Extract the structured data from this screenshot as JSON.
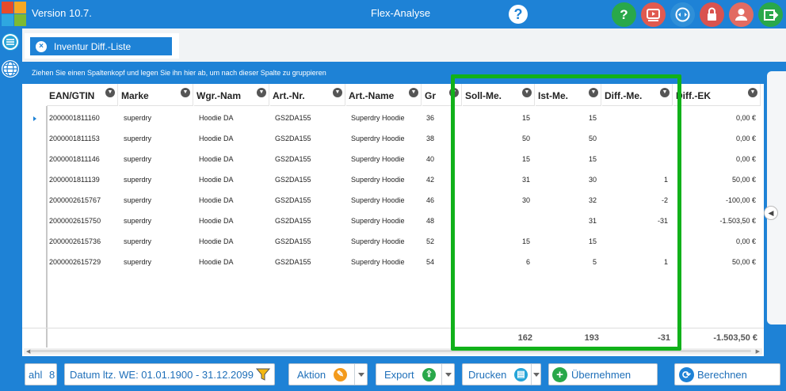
{
  "app": {
    "version": "Version 10.7.",
    "title": "Flex-Analyse"
  },
  "colors": {
    "brand": "#1e82d6",
    "highlight": "#11b11a",
    "toolbar_green": "#29a84a",
    "toolbar_red": "#d9534f"
  },
  "toolbar": {
    "help_center_glyph": "?",
    "help_glyph": "?"
  },
  "tab": {
    "label": "Inventur Diff.-Liste",
    "close_glyph": "×"
  },
  "grid": {
    "group_hint": "Ziehen Sie einen Spaltenkopf und legen Sie ihn hier ab, um nach dieser Spalte zu gruppieren",
    "columns": [
      "EAN/GTIN",
      "Marke",
      "Wgr.-Nam",
      "Art.-Nr.",
      "Art.-Name",
      "Gr",
      "Soll-Me.",
      "Ist-Me.",
      "Diff.-Me.",
      "Diff.-EK"
    ],
    "rows": [
      {
        "ean": "2000001811160",
        "marke": "superdry",
        "wgr": "Hoodie DA",
        "artnr": "GS2DA155",
        "artname": "Superdry Hoodie",
        "gr": "36",
        "soll": "15",
        "ist": "15",
        "diff": "",
        "ek": "0,00 €"
      },
      {
        "ean": "2000001811153",
        "marke": "superdry",
        "wgr": "Hoodie DA",
        "artnr": "GS2DA155",
        "artname": "Superdry Hoodie",
        "gr": "38",
        "soll": "50",
        "ist": "50",
        "diff": "",
        "ek": "0,00 €"
      },
      {
        "ean": "2000001811146",
        "marke": "superdry",
        "wgr": "Hoodie DA",
        "artnr": "GS2DA155",
        "artname": "Superdry Hoodie",
        "gr": "40",
        "soll": "15",
        "ist": "15",
        "diff": "",
        "ek": "0,00 €"
      },
      {
        "ean": "2000001811139",
        "marke": "superdry",
        "wgr": "Hoodie DA",
        "artnr": "GS2DA155",
        "artname": "Superdry Hoodie",
        "gr": "42",
        "soll": "31",
        "ist": "30",
        "diff": "1",
        "ek": "50,00 €"
      },
      {
        "ean": "2000002615767",
        "marke": "superdry",
        "wgr": "Hoodie DA",
        "artnr": "GS2DA155",
        "artname": "Superdry Hoodie",
        "gr": "46",
        "soll": "30",
        "ist": "32",
        "diff": "-2",
        "ek": "-100,00 €"
      },
      {
        "ean": "2000002615750",
        "marke": "superdry",
        "wgr": "Hoodie DA",
        "artnr": "GS2DA155",
        "artname": "Superdry Hoodie",
        "gr": "48",
        "soll": "",
        "ist": "31",
        "diff": "-31",
        "ek": "-1.503,50 €"
      },
      {
        "ean": "2000002615736",
        "marke": "superdry",
        "wgr": "Hoodie DA",
        "artnr": "GS2DA155",
        "artname": "Superdry Hoodie",
        "gr": "52",
        "soll": "15",
        "ist": "15",
        "diff": "",
        "ek": "0,00 €"
      },
      {
        "ean": "2000002615729",
        "marke": "superdry",
        "wgr": "Hoodie DA",
        "artnr": "GS2DA155",
        "artname": "Superdry Hoodie",
        "gr": "54",
        "soll": "6",
        "ist": "5",
        "diff": "1",
        "ek": "50,00 €"
      }
    ],
    "totals": {
      "soll": "162",
      "ist": "193",
      "diff": "-31",
      "ek": "-1.503,50 €"
    }
  },
  "bottom": {
    "count_label": "ahl",
    "count_value": "8",
    "date_filter": "Datum ltz. WE: 01.01.1900 - 31.12.2099",
    "aktion": "Aktion",
    "export": "Export",
    "drucken": "Drucken",
    "uebernehmen": "Übernehmen",
    "berechnen": "Berechnen"
  },
  "icons": {
    "funnel": "filter-icon",
    "menu": "menu-icon",
    "globe": "globe-icon"
  }
}
